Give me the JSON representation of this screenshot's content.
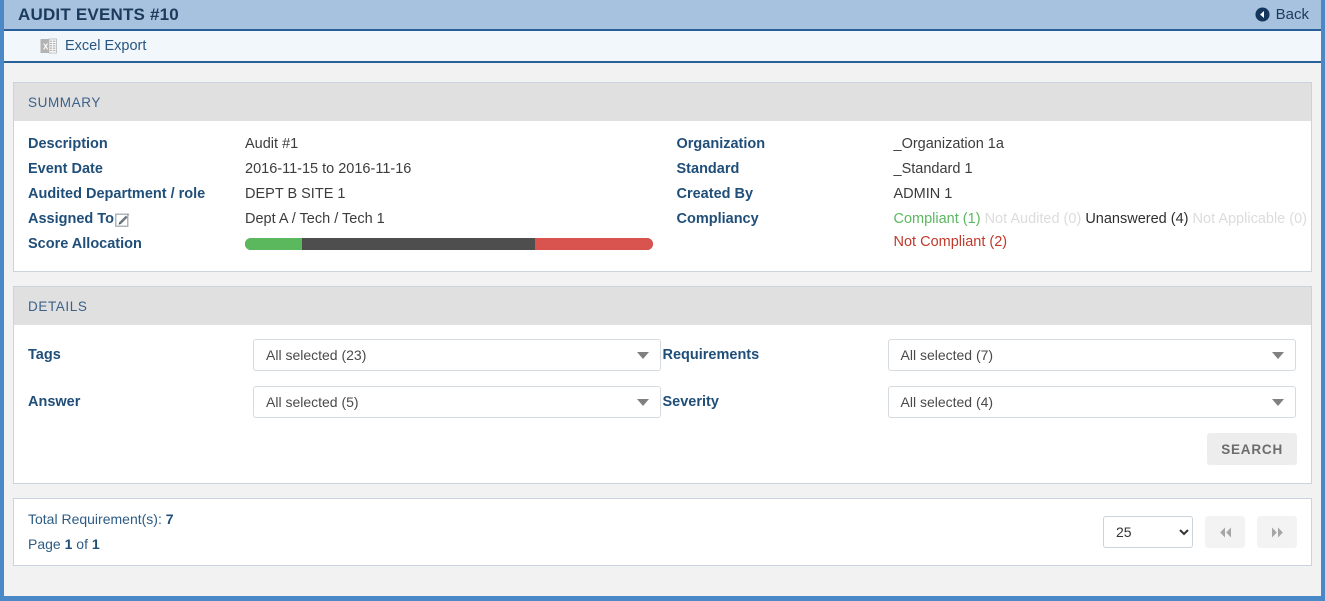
{
  "header": {
    "title": "AUDIT EVENTS #10",
    "back_label": "Back",
    "back_icon": "circle-arrow-left-icon"
  },
  "toolbar": {
    "excel_export_label": "Excel Export",
    "excel_icon": "excel-file-icon"
  },
  "summary": {
    "section_title": "SUMMARY",
    "left": [
      {
        "label": "Description",
        "value": "Audit #1"
      },
      {
        "label": "Event Date",
        "value": "2016-11-15 to 2016-11-16"
      },
      {
        "label": "Audited Department / role",
        "value": "DEPT B SITE 1"
      },
      {
        "label": "Assigned To",
        "value": "Dept A / Tech / Tech 1",
        "icon": "edit-pencil-icon"
      },
      {
        "label": "Score Allocation",
        "value": ""
      }
    ],
    "right": [
      {
        "label": "Organization",
        "value": "_Organization 1a"
      },
      {
        "label": "Standard",
        "value": "_Standard 1"
      },
      {
        "label": "Created By",
        "value": "ADMIN 1"
      }
    ],
    "compliancy_label": "Compliancy",
    "compliancy": [
      {
        "text": "Compliant (1)",
        "color": "#5cb860"
      },
      {
        "text": "Not Audited (0)",
        "color": "#dcdcdc"
      },
      {
        "text": "Unanswered (4)",
        "color": "#2f2f2f"
      },
      {
        "text": "Not Applicable (0)",
        "color": "#dcdcdc"
      },
      {
        "text": "Not Compliant (2)",
        "color": "#c0392b"
      }
    ],
    "score_allocation": {
      "segments": [
        {
          "name": "compliant",
          "percent": 14,
          "color": "#5cb85c"
        },
        {
          "name": "unanswered",
          "percent": 57,
          "color": "#4e4e4e"
        },
        {
          "name": "not-compliant",
          "percent": 29,
          "color": "#d9534f"
        }
      ]
    }
  },
  "details": {
    "section_title": "DETAILS",
    "fields": [
      {
        "label": "Tags",
        "value": "All selected (23)"
      },
      {
        "label": "Requirements",
        "value": "All selected (7)"
      },
      {
        "label": "Answer",
        "value": "All selected (5)"
      },
      {
        "label": "Severity",
        "value": "All selected (4)"
      }
    ],
    "search_label": "SEARCH"
  },
  "footer": {
    "total_label": "Total Requirement(s):",
    "total_value": "7",
    "page_word": "Page",
    "page_current": "1",
    "of_word": "of",
    "page_total": "1",
    "page_size_value": "25",
    "page_size_options": [
      "25"
    ],
    "first_page_icon": "double-chevron-left-icon",
    "last_page_icon": "double-chevron-right-icon"
  }
}
